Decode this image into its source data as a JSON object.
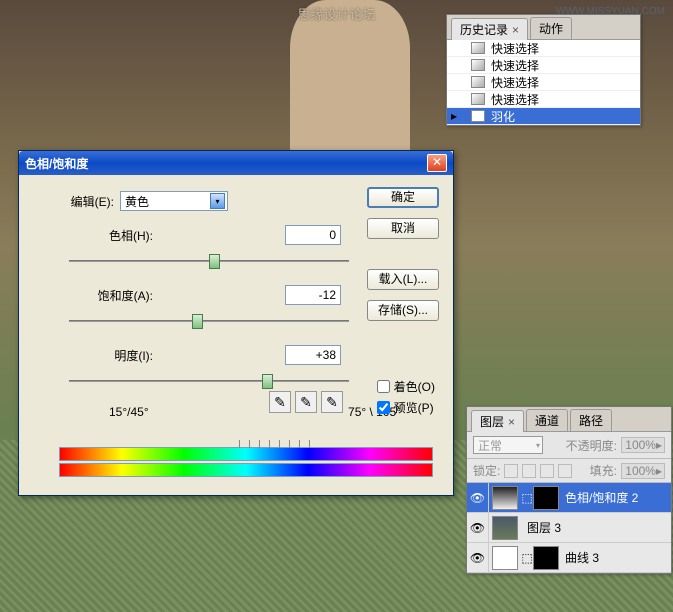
{
  "watermark": "思缘设计论坛",
  "watermark_url": "WWW.MISSYUAN.COM",
  "dialog": {
    "title": "色相/饱和度",
    "edit_label": "编辑(E):",
    "edit_value": "黄色",
    "hue_label": "色相(H):",
    "hue_value": "0",
    "sat_label": "饱和度(A):",
    "sat_value": "-12",
    "light_label": "明度(I):",
    "light_value": "+38",
    "range_left": "15°/45°",
    "range_right": "75° \\ 105°",
    "colorize_label": "着色(O)",
    "preview_label": "预览(P)",
    "btn_ok": "确定",
    "btn_cancel": "取消",
    "btn_load": "载入(L)...",
    "btn_save": "存储(S)..."
  },
  "history": {
    "tab1": "历史记录",
    "tab2": "动作",
    "items": [
      "快速选择",
      "快速选择",
      "快速选择",
      "快速选择",
      "羽化"
    ]
  },
  "layers": {
    "tab1": "图层",
    "tab2": "通道",
    "tab3": "路径",
    "mode": "正常",
    "opacity_label": "不透明度:",
    "opacity_value": "100%",
    "lock_label": "锁定:",
    "fill_label": "填充:",
    "fill_value": "100%",
    "list": [
      {
        "name": "色相/饱和度 2"
      },
      {
        "name": "图层 3"
      },
      {
        "name": "曲线 3"
      }
    ]
  }
}
